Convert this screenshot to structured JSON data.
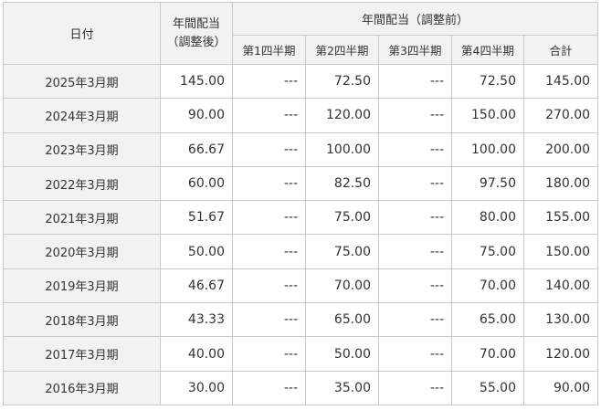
{
  "header": {
    "date_label": "日付",
    "adjusted_line1": "年間配当",
    "adjusted_line2": "（調整後）",
    "unadjusted_group": "年間配当（調整前）",
    "q1": "第1四半期",
    "q2": "第2四半期",
    "q3": "第3四半期",
    "q4": "第4四半期",
    "total": "合計"
  },
  "rows": [
    {
      "date": "2025年3月期",
      "adjusted": "145.00",
      "q1": "---",
      "q2": "72.50",
      "q3": "---",
      "q4": "72.50",
      "total": "145.00"
    },
    {
      "date": "2024年3月期",
      "adjusted": "90.00",
      "q1": "---",
      "q2": "120.00",
      "q3": "---",
      "q4": "150.00",
      "total": "270.00"
    },
    {
      "date": "2023年3月期",
      "adjusted": "66.67",
      "q1": "---",
      "q2": "100.00",
      "q3": "---",
      "q4": "100.00",
      "total": "200.00"
    },
    {
      "date": "2022年3月期",
      "adjusted": "60.00",
      "q1": "---",
      "q2": "82.50",
      "q3": "---",
      "q4": "97.50",
      "total": "180.00"
    },
    {
      "date": "2021年3月期",
      "adjusted": "51.67",
      "q1": "---",
      "q2": "75.00",
      "q3": "---",
      "q4": "80.00",
      "total": "155.00"
    },
    {
      "date": "2020年3月期",
      "adjusted": "50.00",
      "q1": "---",
      "q2": "75.00",
      "q3": "---",
      "q4": "75.00",
      "total": "150.00"
    },
    {
      "date": "2019年3月期",
      "adjusted": "46.67",
      "q1": "---",
      "q2": "70.00",
      "q3": "---",
      "q4": "70.00",
      "total": "140.00"
    },
    {
      "date": "2018年3月期",
      "adjusted": "43.33",
      "q1": "---",
      "q2": "65.00",
      "q3": "---",
      "q4": "65.00",
      "total": "130.00"
    },
    {
      "date": "2017年3月期",
      "adjusted": "40.00",
      "q1": "---",
      "q2": "50.00",
      "q3": "---",
      "q4": "70.00",
      "total": "120.00"
    },
    {
      "date": "2016年3月期",
      "adjusted": "30.00",
      "q1": "---",
      "q2": "35.00",
      "q3": "---",
      "q4": "55.00",
      "total": "90.00"
    }
  ]
}
